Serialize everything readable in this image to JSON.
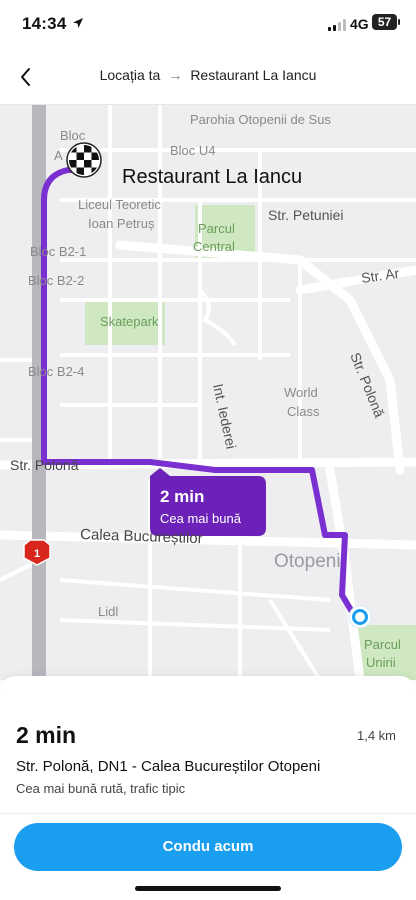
{
  "status_bar": {
    "time": "14:34",
    "network": "4G",
    "battery": "57"
  },
  "header": {
    "origin": "Locația ta",
    "arrow": "→",
    "destination": "Restaurant La Iancu"
  },
  "map": {
    "destination_label": "Restaurant La Iancu",
    "route_badge": {
      "eta": "2 min",
      "label": "Cea mai bună"
    },
    "road_shield": "1",
    "labels": {
      "bloc_a1": "Bloc",
      "bloc_a2": "A",
      "bloc_u4": "Bloc U4",
      "parohia": "Parohia Otopenii de Sus",
      "liceul1": "Liceul Teoretic",
      "liceul2": "Ioan Petruș",
      "parcul_central1": "Parcul",
      "parcul_central2": "Central",
      "str_petuniei": "Str. Petuniei",
      "str_ar": "Str. Ar",
      "bloc_b2_1": "Bloc B2-1",
      "bloc_b2_2": "Bloc B2-2",
      "skatepark": "Skatepark",
      "str_polona_v": "Str. Polonă",
      "bloc_b2_4": "Bloc B2-4",
      "int_iederei": "Int. Iederei",
      "world_class1": "World",
      "world_class2": "Class",
      "str_polona_h": "Str. Polonă",
      "calea_bucurestilor": "Calea Bucureștilor",
      "otopeni": "Otopeni",
      "lidl": "Lidl",
      "parcul_unirii1": "Parcul",
      "parcul_unirii2": "Unirii"
    }
  },
  "sheet": {
    "eta": "2 min",
    "distance": "1,4 km",
    "route_name": "Str. Polonă, DN1 - Calea Bucureștilor Otopeni",
    "route_desc": "Cea mai bună rută, trafic tipic",
    "go_button": "Condu acum"
  },
  "colors": {
    "route": "#7a2fd0",
    "accent": "#1a9ef0",
    "badge": "#6c22b8"
  }
}
